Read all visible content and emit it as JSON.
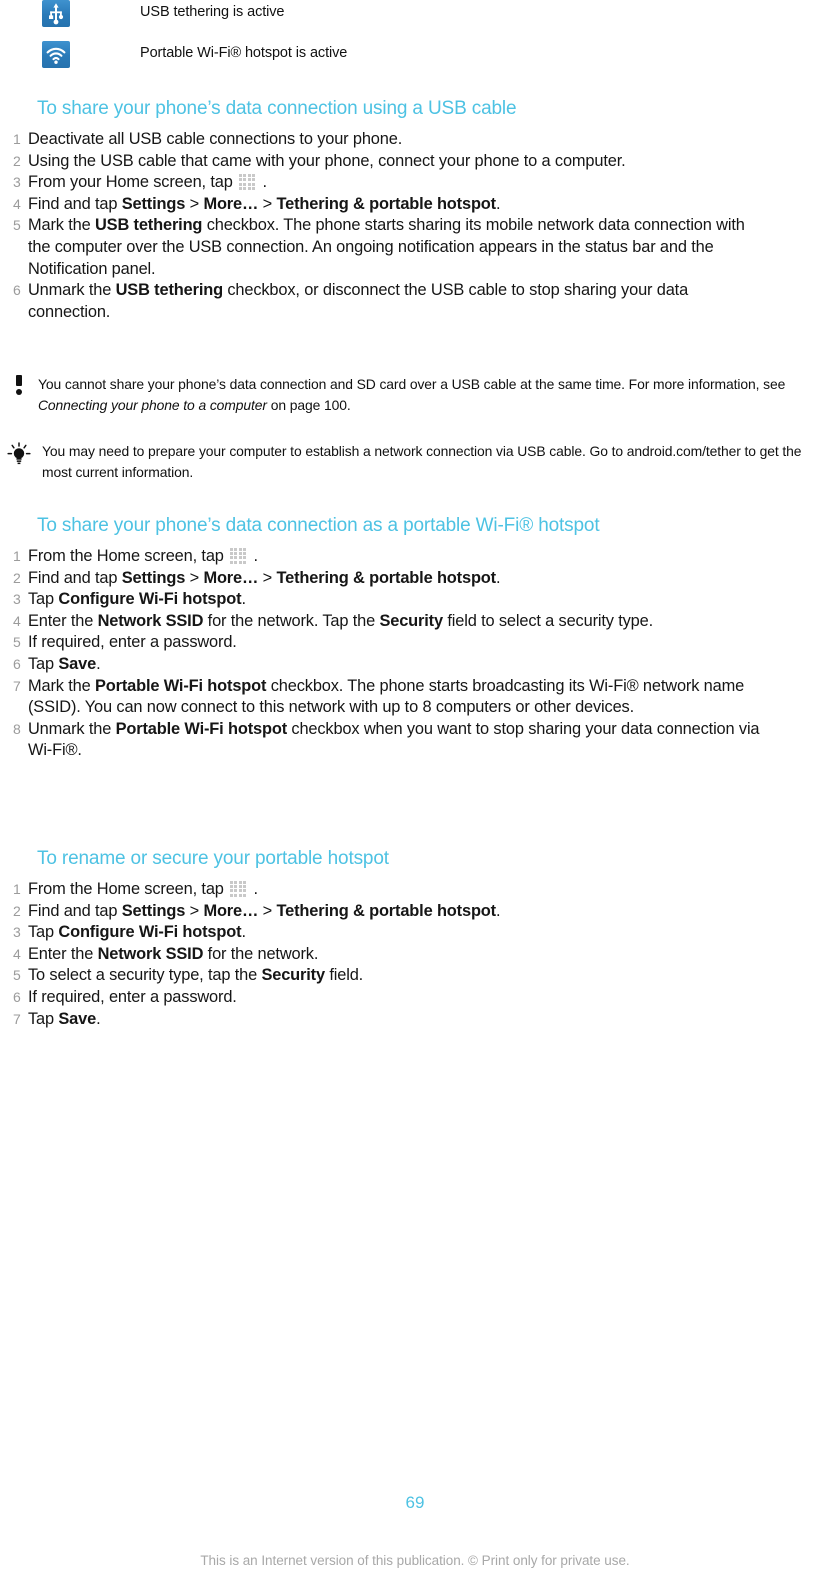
{
  "status_rows": [
    {
      "icon": "usb-icon",
      "label": "USB tethering is active"
    },
    {
      "icon": "wifi-icon",
      "label": "Portable Wi-Fi® hotspot is active"
    }
  ],
  "sections": [
    {
      "heading": "To share your phone’s data connection using a USB cable",
      "steps": [
        {
          "num": "1",
          "text": "Deactivate all USB cable connections to your phone."
        },
        {
          "num": "2",
          "text": "Using the USB cable that came with your phone, connect your phone to a computer."
        },
        {
          "num": "3",
          "text": "From your Home screen, tap ▦ ."
        },
        {
          "num": "4",
          "text": "Find and tap Settings > More… > Tethering & portable hotspot."
        },
        {
          "num": "5",
          "text": "Mark the USB tethering checkbox. The phone starts sharing its mobile network data connection with the computer over the USB connection. An ongoing notification appears in the status bar and the Notification panel."
        },
        {
          "num": "6",
          "text": "Unmark the USB tethering checkbox, or disconnect the USB cable to stop sharing your data connection."
        }
      ]
    },
    {
      "heading": "To share your phone’s data connection as a portable Wi-Fi® hotspot",
      "steps": [
        {
          "num": "1",
          "text": "From the Home screen, tap ▦ ."
        },
        {
          "num": "2",
          "text": "Find and tap Settings > More… > Tethering & portable hotspot."
        },
        {
          "num": "3",
          "text": "Tap Configure Wi-Fi hotspot."
        },
        {
          "num": "4",
          "text": "Enter the Network SSID for the network. Tap the Security field to select a security type."
        },
        {
          "num": "5",
          "text": "If required, enter a password."
        },
        {
          "num": "6",
          "text": "Tap Save."
        },
        {
          "num": "7",
          "text": "Mark the Portable Wi-Fi hotspot checkbox. The phone starts broadcasting its Wi-Fi® network name (SSID). You can now connect to this network with up to 8 computers or other devices."
        },
        {
          "num": "8",
          "text": "Unmark the Portable Wi-Fi hotspot checkbox when you want to stop sharing your data connection via Wi-Fi®."
        }
      ]
    },
    {
      "heading": "To rename or secure your portable hotspot",
      "steps": [
        {
          "num": "1",
          "text": "From the Home screen, tap ▦ ."
        },
        {
          "num": "2",
          "text": "Find and tap Settings > More… > Tethering & portable hotspot."
        },
        {
          "num": "3",
          "text": "Tap Configure Wi-Fi hotspot."
        },
        {
          "num": "4",
          "text": "Enter the Network SSID for the network."
        },
        {
          "num": "5",
          "text": "To select a security type, tap the Security field."
        },
        {
          "num": "6",
          "text": "If required, enter a password."
        },
        {
          "num": "7",
          "text": "Tap Save."
        }
      ]
    }
  ],
  "callouts": [
    {
      "icon": "exclamation-icon",
      "line1_a": "You cannot share your phone’s data connection and SD card over a USB cable at the same",
      "line2_a": "time. For more information, see ",
      "line2_italic": "Connecting your phone to a computer",
      "line2_b": " on page 100."
    },
    {
      "icon": "lightbulb-icon",
      "line1_a": "You may need to prepare your computer to establish a network connection via USB cable. Go",
      "line2_a": "to android.com/tether to get the most current information."
    }
  ],
  "footer": {
    "page_number": "69",
    "notice": "This is an Internet version of this publication. © Print only for private use."
  },
  "colors": {
    "heading": "#4dc2e3",
    "step_number": "#9b9b9b",
    "icon_blue": "#2a7ab8",
    "footer_note": "#a8a8a8"
  }
}
